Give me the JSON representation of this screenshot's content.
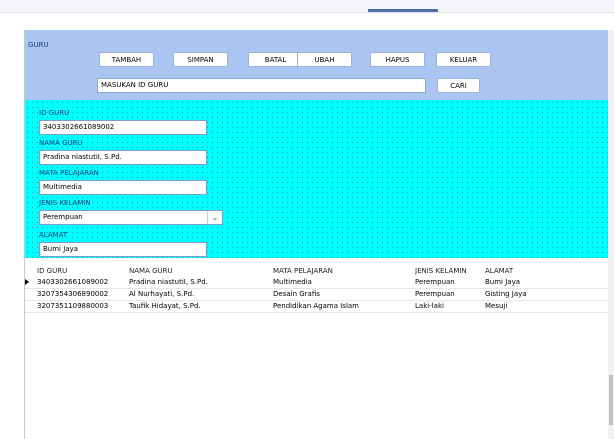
{
  "form": {
    "group_label": "GURU",
    "buttons": {
      "tambah": "TAMBAH",
      "simpan": "SIMPAN",
      "batal": "BATAL",
      "ubah": "UBAH",
      "hapus": "HAPUS",
      "keluar": "KELUAR",
      "cari": "CARI"
    },
    "search_value": "MASUKAN ID GURU"
  },
  "fields": {
    "id_guru": {
      "label": "ID GURU",
      "value": "3403302661089002"
    },
    "nama_guru": {
      "label": "NAMA GURU",
      "value": "Pradina niastutiI, S.Pd."
    },
    "mata_pelajaran": {
      "label": "MATA PELAJARAN",
      "value": "Multimedia"
    },
    "jenis_kelamin": {
      "label": "JENIS KELAMIN",
      "value": "Perempuan"
    },
    "alamat": {
      "label": "ALAMAT",
      "value": "Bumi Jaya"
    }
  },
  "grid": {
    "columns": [
      "ID GURU",
      "NAMA GURU",
      "MATA PELAJARAN",
      "JENIS KELAMIN",
      "ALAMAT"
    ],
    "rows": [
      [
        "3403302661089002",
        "Pradina niastutiI, S.Pd.",
        "Multimedia",
        "Perempuan",
        "Bumi Jaya"
      ],
      [
        "3207354306890002",
        "Al Nurhayati, S.Pd.",
        "Desain Grafis",
        "Perempuan",
        "Gisting Jaya"
      ],
      [
        "3207351109880003",
        "Taufik Hidayat, S.Pd.",
        "Pendidikan Agama Islam",
        "Laki-laki",
        "Mesuji"
      ]
    ],
    "selected_row": 0
  },
  "icons": {
    "combo_arrow": "chevron-down-icon",
    "row_indicator": "current-row-indicator-icon"
  },
  "colors": {
    "top_panel": "#aac5f1",
    "form_panel": "#00ffff"
  }
}
